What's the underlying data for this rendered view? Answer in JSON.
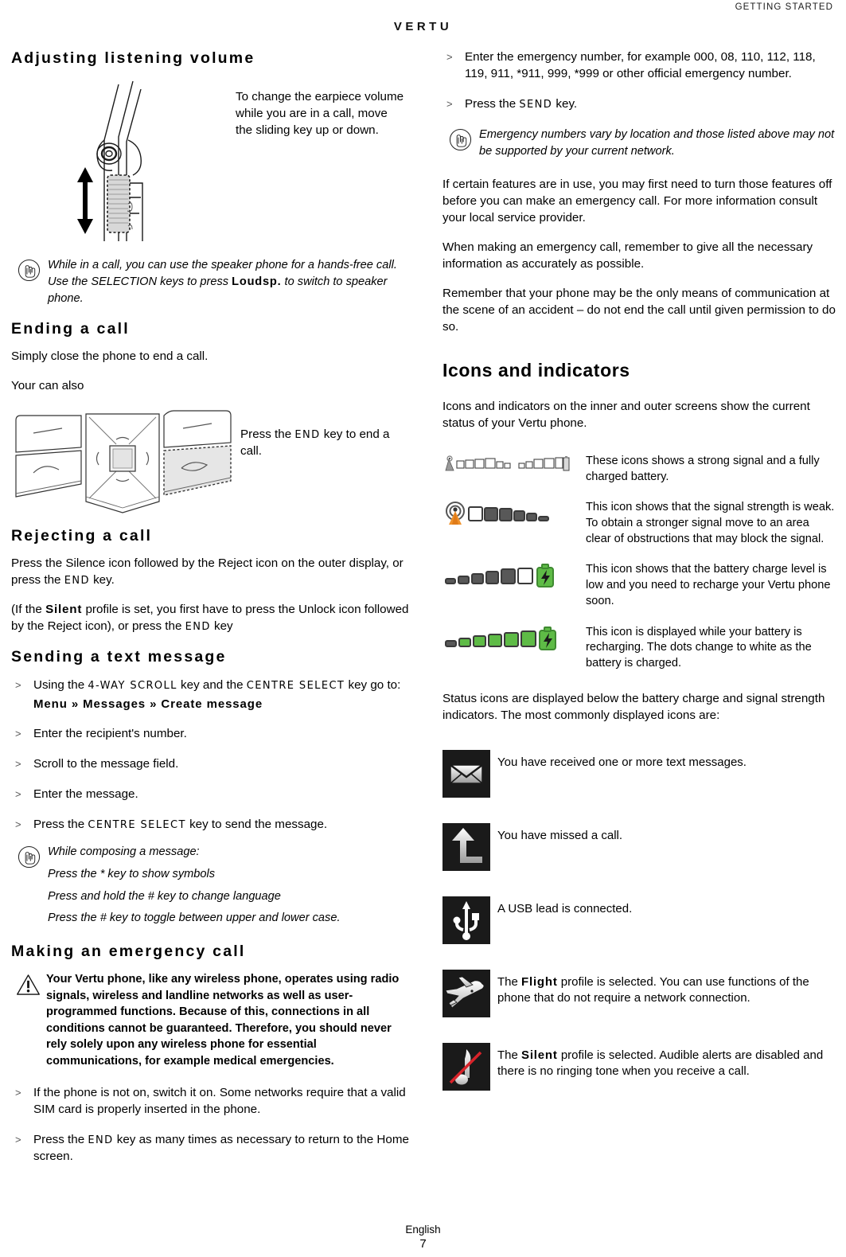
{
  "header": {
    "section": "GETTING STARTED",
    "logo": "VERTU"
  },
  "footer": {
    "language": "English",
    "page": "7"
  },
  "left": {
    "h_volume": "Adjusting listening volume",
    "volume_caption": "To change the earpiece volume while you are in a call, move the sliding key up or down.",
    "note_speaker": {
      "icon": "hand-pointing-icon",
      "part1": "While in a call, you can use the speaker phone for a hands-free call. Use the SELECTION keys to press ",
      "bold": "Loudsp.",
      "part2": " to switch to speaker phone."
    },
    "h_ending": "Ending a call",
    "ending_p1": "Simply close the phone to end a call.",
    "ending_p2": "Your can also",
    "end_caption_pre": "Press the ",
    "end_caption_key": "END",
    "end_caption_post": " key to end a call.",
    "h_rejecting": "Rejecting a call",
    "reject_p1_a": "Press the Silence icon followed by the Reject icon on the outer display, or press the ",
    "reject_p1_key": "END",
    "reject_p1_b": " key.",
    "reject_p2_a": "(If the ",
    "reject_p2_bold": "Silent",
    "reject_p2_b": " profile is set, you first have to press the Unlock icon followed by the Reject icon), or press the ",
    "reject_p2_key": "END",
    "reject_p2_c": " key",
    "h_sending": "Sending a text message",
    "steps": [
      {
        "pre": "Using the ",
        "key1": "4-WAY SCROLL",
        "mid": " key and the ",
        "key2": "CENTRE SELECT",
        "post": " key go to:",
        "submenu": "Menu » Messages » Create message"
      },
      {
        "text": "Enter the recipient's number."
      },
      {
        "text": "Scroll to the message field."
      },
      {
        "text": "Enter the message."
      },
      {
        "pre": "Press the ",
        "key1": "CENTRE SELECT",
        "post": " key to send the message."
      }
    ],
    "note_composing": {
      "icon": "hand-pointing-icon",
      "lines": [
        "While composing a message:",
        "Press the * key to show symbols",
        "Press and hold the # key to change language",
        "Press the # key to toggle between upper and lower case."
      ]
    },
    "h_emergency": "Making an emergency call",
    "warning": {
      "icon": "warning-triangle-icon",
      "text": "Your Vertu phone, like any wireless phone, operates using radio signals, wireless and landline networks as well as user-programmed functions. Because of this, connections in all conditions cannot be guaranteed. Therefore, you should never rely solely upon any wireless phone for essential communications, for example medical emergencies."
    },
    "steps2": [
      {
        "text": "If the phone is not on, switch it on. Some networks require that a valid SIM card is properly inserted in the phone."
      },
      {
        "pre": "Press the ",
        "key1": "END",
        "post": " key as many times as necessary to return to the Home screen."
      }
    ]
  },
  "right": {
    "steps": [
      {
        "text": "Enter the emergency number, for example 000, 08, 110, 112, 118, 119, 911, *911, 999, *999 or other official emergency number."
      },
      {
        "pre": "Press the ",
        "key1": "SEND",
        "post": " key."
      }
    ],
    "note_emergency": {
      "icon": "hand-pointing-icon",
      "text": "Emergency numbers vary by location and those listed above may not be supported by your current network."
    },
    "p1": "If certain features are in use, you may first need to turn those features off before you can make an emergency call. For more information consult your local service provider.",
    "p2": "When making an emergency call, remember to give all the necessary information as accurately as possible.",
    "p3": "Remember that your phone may be the only means of communication at the scene of an accident – do not end the call until given permission to do so.",
    "h_icons": "Icons and indicators",
    "icons_intro": "Icons and indicators on the inner and outer screens show the current status of your Vertu phone.",
    "indicators": [
      {
        "icon": "signal-full-battery-full-icon",
        "desc": "These icons shows a strong signal and a fully charged battery."
      },
      {
        "icon": "signal-weak-icon",
        "desc": "This icon shows that the signal strength is weak. To obtain a stronger signal move to an area clear of obstructions that may block the signal."
      },
      {
        "icon": "battery-low-icon",
        "desc": "This icon shows that the battery charge level is low and you need to recharge your Vertu phone soon."
      },
      {
        "icon": "battery-charging-icon",
        "desc": "This icon is displayed while your battery is recharging. The dots change to white as the battery is charged."
      }
    ],
    "status_intro": "Status icons are displayed below the battery charge and signal strength indicators. The most commonly displayed icons are:",
    "status_icons": [
      {
        "icon": "envelope-icon",
        "desc": "You have received one or more text messages."
      },
      {
        "icon": "missed-call-icon",
        "desc": "You have missed a call."
      },
      {
        "icon": "usb-icon",
        "desc": "A USB lead is connected."
      },
      {
        "icon": "airplane-icon",
        "pre": "The ",
        "bold": "Flight",
        "post": " profile is selected. You can use functions of the phone that do not require a network connection."
      },
      {
        "icon": "silent-note-icon",
        "pre": "The ",
        "bold": "Silent",
        "post": " profile is selected. Audible alerts are disabled and there is no ringing tone when you receive a call."
      }
    ]
  },
  "colors": {
    "accent_orange": "#F0922B",
    "green": "#5EBB46",
    "gray_bar": "#585858",
    "red_slash": "#D8232A"
  }
}
